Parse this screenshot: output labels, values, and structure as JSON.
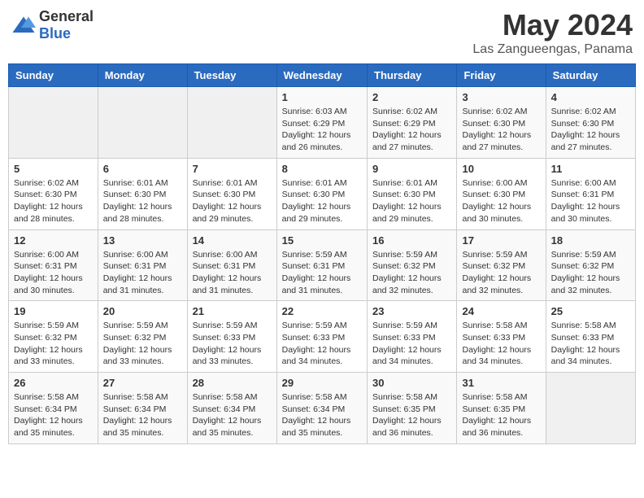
{
  "logo": {
    "general": "General",
    "blue": "Blue"
  },
  "title": "May 2024",
  "location": "Las Zangueengas, Panama",
  "weekdays": [
    "Sunday",
    "Monday",
    "Tuesday",
    "Wednesday",
    "Thursday",
    "Friday",
    "Saturday"
  ],
  "weeks": [
    [
      {
        "day": "",
        "sunrise": "",
        "sunset": "",
        "daylight": ""
      },
      {
        "day": "",
        "sunrise": "",
        "sunset": "",
        "daylight": ""
      },
      {
        "day": "",
        "sunrise": "",
        "sunset": "",
        "daylight": ""
      },
      {
        "day": "1",
        "sunrise": "6:03 AM",
        "sunset": "6:29 PM",
        "daylight": "12 hours and 26 minutes."
      },
      {
        "day": "2",
        "sunrise": "6:02 AM",
        "sunset": "6:29 PM",
        "daylight": "12 hours and 27 minutes."
      },
      {
        "day": "3",
        "sunrise": "6:02 AM",
        "sunset": "6:30 PM",
        "daylight": "12 hours and 27 minutes."
      },
      {
        "day": "4",
        "sunrise": "6:02 AM",
        "sunset": "6:30 PM",
        "daylight": "12 hours and 27 minutes."
      }
    ],
    [
      {
        "day": "5",
        "sunrise": "6:02 AM",
        "sunset": "6:30 PM",
        "daylight": "12 hours and 28 minutes."
      },
      {
        "day": "6",
        "sunrise": "6:01 AM",
        "sunset": "6:30 PM",
        "daylight": "12 hours and 28 minutes."
      },
      {
        "day": "7",
        "sunrise": "6:01 AM",
        "sunset": "6:30 PM",
        "daylight": "12 hours and 29 minutes."
      },
      {
        "day": "8",
        "sunrise": "6:01 AM",
        "sunset": "6:30 PM",
        "daylight": "12 hours and 29 minutes."
      },
      {
        "day": "9",
        "sunrise": "6:01 AM",
        "sunset": "6:30 PM",
        "daylight": "12 hours and 29 minutes."
      },
      {
        "day": "10",
        "sunrise": "6:00 AM",
        "sunset": "6:30 PM",
        "daylight": "12 hours and 30 minutes."
      },
      {
        "day": "11",
        "sunrise": "6:00 AM",
        "sunset": "6:31 PM",
        "daylight": "12 hours and 30 minutes."
      }
    ],
    [
      {
        "day": "12",
        "sunrise": "6:00 AM",
        "sunset": "6:31 PM",
        "daylight": "12 hours and 30 minutes."
      },
      {
        "day": "13",
        "sunrise": "6:00 AM",
        "sunset": "6:31 PM",
        "daylight": "12 hours and 31 minutes."
      },
      {
        "day": "14",
        "sunrise": "6:00 AM",
        "sunset": "6:31 PM",
        "daylight": "12 hours and 31 minutes."
      },
      {
        "day": "15",
        "sunrise": "5:59 AM",
        "sunset": "6:31 PM",
        "daylight": "12 hours and 31 minutes."
      },
      {
        "day": "16",
        "sunrise": "5:59 AM",
        "sunset": "6:32 PM",
        "daylight": "12 hours and 32 minutes."
      },
      {
        "day": "17",
        "sunrise": "5:59 AM",
        "sunset": "6:32 PM",
        "daylight": "12 hours and 32 minutes."
      },
      {
        "day": "18",
        "sunrise": "5:59 AM",
        "sunset": "6:32 PM",
        "daylight": "12 hours and 32 minutes."
      }
    ],
    [
      {
        "day": "19",
        "sunrise": "5:59 AM",
        "sunset": "6:32 PM",
        "daylight": "12 hours and 33 minutes."
      },
      {
        "day": "20",
        "sunrise": "5:59 AM",
        "sunset": "6:32 PM",
        "daylight": "12 hours and 33 minutes."
      },
      {
        "day": "21",
        "sunrise": "5:59 AM",
        "sunset": "6:33 PM",
        "daylight": "12 hours and 33 minutes."
      },
      {
        "day": "22",
        "sunrise": "5:59 AM",
        "sunset": "6:33 PM",
        "daylight": "12 hours and 34 minutes."
      },
      {
        "day": "23",
        "sunrise": "5:59 AM",
        "sunset": "6:33 PM",
        "daylight": "12 hours and 34 minutes."
      },
      {
        "day": "24",
        "sunrise": "5:58 AM",
        "sunset": "6:33 PM",
        "daylight": "12 hours and 34 minutes."
      },
      {
        "day": "25",
        "sunrise": "5:58 AM",
        "sunset": "6:33 PM",
        "daylight": "12 hours and 34 minutes."
      }
    ],
    [
      {
        "day": "26",
        "sunrise": "5:58 AM",
        "sunset": "6:34 PM",
        "daylight": "12 hours and 35 minutes."
      },
      {
        "day": "27",
        "sunrise": "5:58 AM",
        "sunset": "6:34 PM",
        "daylight": "12 hours and 35 minutes."
      },
      {
        "day": "28",
        "sunrise": "5:58 AM",
        "sunset": "6:34 PM",
        "daylight": "12 hours and 35 minutes."
      },
      {
        "day": "29",
        "sunrise": "5:58 AM",
        "sunset": "6:34 PM",
        "daylight": "12 hours and 35 minutes."
      },
      {
        "day": "30",
        "sunrise": "5:58 AM",
        "sunset": "6:35 PM",
        "daylight": "12 hours and 36 minutes."
      },
      {
        "day": "31",
        "sunrise": "5:58 AM",
        "sunset": "6:35 PM",
        "daylight": "12 hours and 36 minutes."
      },
      {
        "day": "",
        "sunrise": "",
        "sunset": "",
        "daylight": ""
      }
    ]
  ]
}
